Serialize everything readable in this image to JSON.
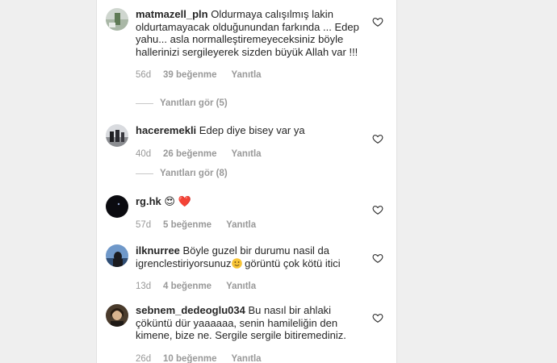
{
  "comments": [
    {
      "username": "matmazell_pln",
      "text": "Oldurmaya calışılmış lakin oldurtamayacak olduğunundan farkında ... Edep yahu... asla normalleştiremeyeceksiniz böyle hallerinizi sergileyerek sizden büyük Allah var !!!",
      "age": "56d",
      "likes": "39 beğenme",
      "reply": "Yanıtla",
      "view_replies": "Yanıtları gör (5)"
    },
    {
      "username": "haceremekli",
      "text": "Edep diye bisey var ya",
      "age": "40d",
      "likes": "26 beğenme",
      "reply": "Yanıtla",
      "view_replies": "Yanıtları gör (8)"
    },
    {
      "username": "rg.hk",
      "text": "😍 ❤️",
      "age": "57d",
      "likes": "5 beğenme",
      "reply": "Yanıtla"
    },
    {
      "username": "ilknurree",
      "text_before": "Böyle guzel bir durumu nasil da igrenclestiriyorsunuz",
      "text_after": " görüntü çok kötü itici",
      "age": "13d",
      "likes": "4 beğenme",
      "reply": "Yanıtla"
    },
    {
      "username": "sebnem_dedeoglu034",
      "text": "Bu nasıl bir ahlaki çöküntü dür yaaaaaa, senin hamileliğin den kimene, bize ne. Sergile sergile bitiremediniz.",
      "age": "26d",
      "likes": "10 beğenme",
      "reply": "Yanıtla"
    }
  ],
  "icons": {
    "like": "heart-outline-icon",
    "emoji_smile": "slightly-smiling-face-emoji",
    "emoji_heart_eyes": "heart-eyes-emoji",
    "emoji_red_heart": "red-heart-emoji"
  },
  "colors": {
    "text": "#262626",
    "meta": "#999999",
    "panel": "#ffffff",
    "background": "#efefef"
  }
}
